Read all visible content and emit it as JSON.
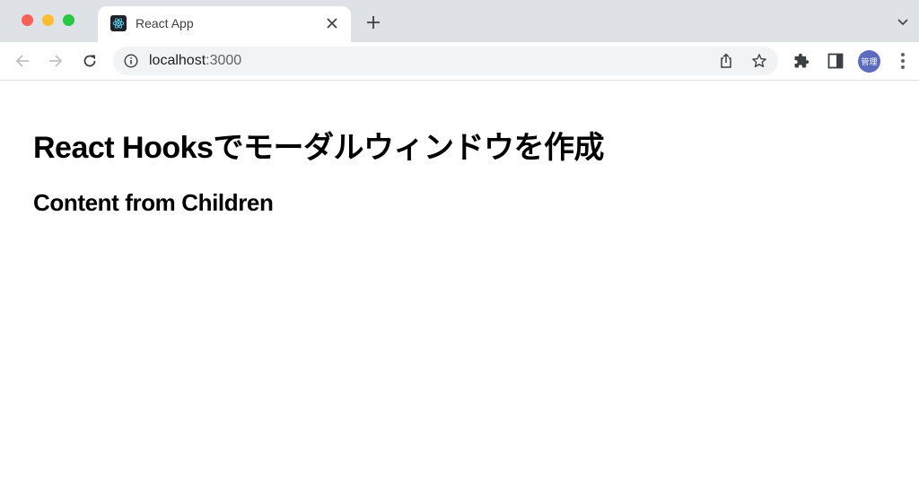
{
  "browser": {
    "tab": {
      "title": "React App",
      "favicon": "react-logo-icon"
    },
    "new_tab_label": "+",
    "address": {
      "host": "localhost",
      "port": ":3000"
    },
    "profile": {
      "label": "管理",
      "color": "#5c6bc0"
    }
  },
  "page": {
    "heading": "React Hooksでモーダルウィンドウを作成",
    "subheading": "Content from Children"
  }
}
